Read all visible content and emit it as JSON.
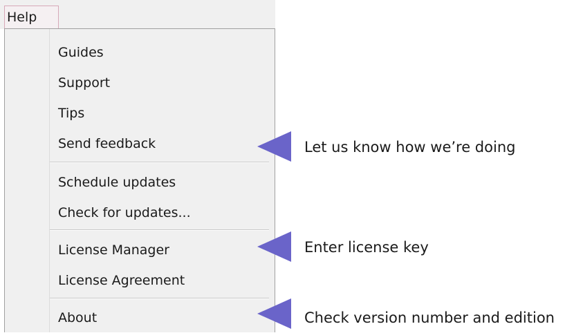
{
  "menubar": {
    "help_label": "Help"
  },
  "menu": {
    "items": [
      {
        "label": "Guides"
      },
      {
        "label": "Support"
      },
      {
        "label": "Tips"
      },
      {
        "label": "Send feedback"
      },
      {
        "label": "Schedule updates"
      },
      {
        "label": "Check for updates..."
      },
      {
        "label": "License Manager"
      },
      {
        "label": "License Agreement"
      },
      {
        "label": "About"
      }
    ]
  },
  "callouts": {
    "feedback": "Let us know how we’re doing",
    "license": "Enter license key",
    "about": "Check version number and edition"
  },
  "colors": {
    "pointer": "#6a64c9",
    "menu_background": "#f0f0f0",
    "menubar_highlight_border": "#d7a8b8"
  }
}
